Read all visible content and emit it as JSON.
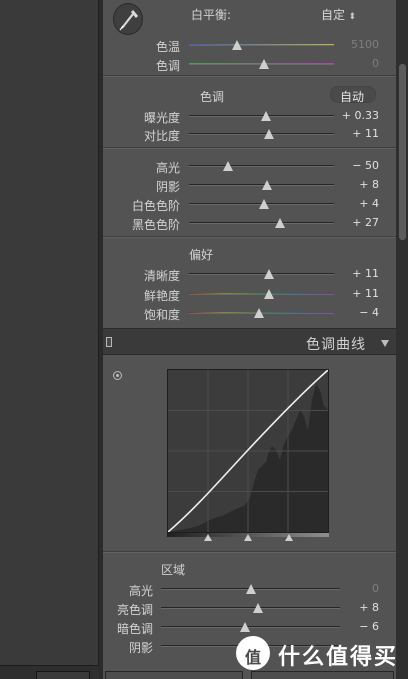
{
  "white_balance": {
    "label": "白平衡:",
    "value": "自定",
    "temp": {
      "label": "色温",
      "value": "5100",
      "position": 0.33
    },
    "tint": {
      "label": "色调",
      "value": "0",
      "position": 0.52
    }
  },
  "tone": {
    "title": "色调",
    "auto_label": "自动",
    "sliders": [
      {
        "label": "曝光度",
        "value": "+ 0.33",
        "position": 0.53
      },
      {
        "label": "对比度",
        "value": "+ 11",
        "position": 0.55
      },
      {
        "label": "高光",
        "value": "− 50",
        "position": 0.27
      },
      {
        "label": "阴影",
        "value": "+ 8",
        "position": 0.54
      },
      {
        "label": "白色色阶",
        "value": "+ 4",
        "position": 0.52
      },
      {
        "label": "黑色色阶",
        "value": "+ 27",
        "position": 0.63
      }
    ]
  },
  "presence": {
    "title": "偏好",
    "sliders": [
      {
        "label": "清晰度",
        "value": "+ 11",
        "position": 0.55
      },
      {
        "label": "鲜艳度",
        "value": "+ 11",
        "position": 0.55
      },
      {
        "label": "饱和度",
        "value": "− 4",
        "position": 0.48
      }
    ]
  },
  "tone_curve": {
    "title": "色调曲线",
    "region_title": "区域",
    "sliders": [
      {
        "label": "高光",
        "value": "0",
        "position": 0.5
      },
      {
        "label": "亮色调",
        "value": "+ 8",
        "position": 0.54
      },
      {
        "label": "暗色调",
        "value": "− 6",
        "position": 0.47
      },
      {
        "label": "阴影",
        "value": "",
        "position": 0.5
      }
    ],
    "handles": [
      0.25,
      0.5,
      0.75
    ]
  },
  "watermark": {
    "logo": "值",
    "text": "什么值得买"
  },
  "colors": {
    "panel": "#535353",
    "dark": "#2b2b2b",
    "text": "#d4d4d4"
  }
}
